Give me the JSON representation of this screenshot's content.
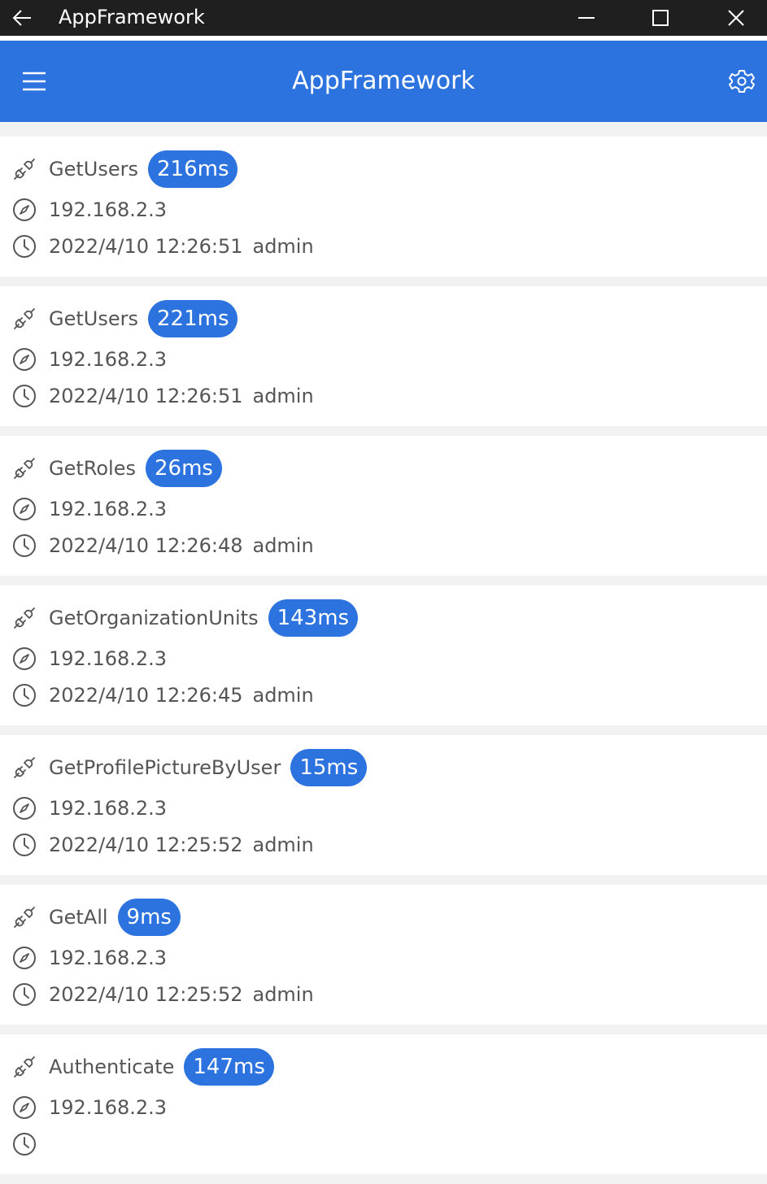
{
  "window": {
    "title": "AppFramework"
  },
  "appbar": {
    "title": "AppFramework"
  },
  "logs": [
    {
      "method": "GetUsers",
      "duration": "216ms",
      "ip": "192.168.2.3",
      "time": "2022/4/10 12:26:51",
      "user": "admin"
    },
    {
      "method": "GetUsers",
      "duration": "221ms",
      "ip": "192.168.2.3",
      "time": "2022/4/10 12:26:51",
      "user": "admin"
    },
    {
      "method": "GetRoles",
      "duration": "26ms",
      "ip": "192.168.2.3",
      "time": "2022/4/10 12:26:48",
      "user": "admin"
    },
    {
      "method": "GetOrganizationUnits",
      "duration": "143ms",
      "ip": "192.168.2.3",
      "time": "2022/4/10 12:26:45",
      "user": "admin"
    },
    {
      "method": "GetProfilePictureByUser",
      "duration": "15ms",
      "ip": "192.168.2.3",
      "time": "2022/4/10 12:25:52",
      "user": "admin"
    },
    {
      "method": "GetAll",
      "duration": "9ms",
      "ip": "192.168.2.3",
      "time": "2022/4/10 12:25:52",
      "user": "admin"
    },
    {
      "method": "Authenticate",
      "duration": "147ms",
      "ip": "192.168.2.3",
      "time": "",
      "user": ""
    }
  ],
  "icons": {
    "back": "arrow-left-icon",
    "minimize": "minimize-icon",
    "maximize": "maximize-icon",
    "close": "close-icon",
    "menu": "hamburger-menu-icon",
    "settings": "gear-icon",
    "method": "plug-icon",
    "ip": "compass-icon",
    "time": "clock-icon"
  },
  "colors": {
    "accent": "#2c73e0",
    "titlebar": "#1f1f1f",
    "text": "#555555"
  }
}
